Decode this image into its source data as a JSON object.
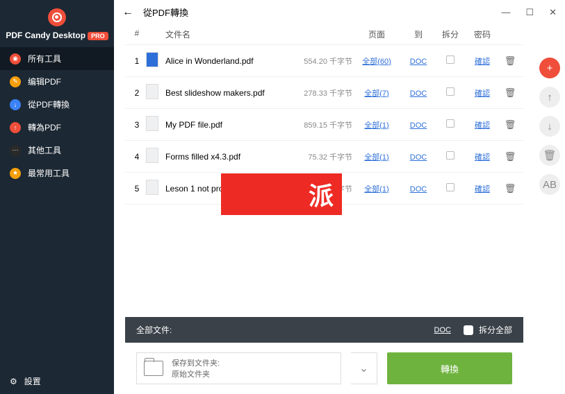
{
  "app": {
    "name": "PDF Candy Desktop",
    "badge": "PRO"
  },
  "window": {
    "title": "從PDF轉換"
  },
  "sidebar": {
    "items": [
      {
        "label": "所有工具"
      },
      {
        "label": "编辑PDF"
      },
      {
        "label": "從PDF轉換"
      },
      {
        "label": "轉為PDF"
      },
      {
        "label": "其他工具"
      },
      {
        "label": "最常用工具"
      }
    ],
    "settings": "設置"
  },
  "table": {
    "headers": {
      "num": "#",
      "name": "文件名",
      "pages": "页面",
      "to": "到",
      "split": "拆分",
      "pwd": "密码"
    },
    "rows": [
      {
        "num": "1",
        "name": "Alice in Wonderland.pdf",
        "size": "554.20 千字节",
        "pages": "全部(60)",
        "to": "DOC",
        "pwd": "確認"
      },
      {
        "num": "2",
        "name": "Best slideshow makers.pdf",
        "size": "278.33 千字节",
        "pages": "全部(7)",
        "to": "DOC",
        "pwd": "確認"
      },
      {
        "num": "3",
        "name": "My PDF file.pdf",
        "size": "859.15 千字节",
        "pages": "全部(1)",
        "to": "DOC",
        "pwd": "確認"
      },
      {
        "num": "4",
        "name": "Forms filled x4.3.pdf",
        "size": "75.32 千字节",
        "pages": "全部(1)",
        "to": "DOC",
        "pwd": "確認"
      },
      {
        "num": "5",
        "name": "Leson 1 not protected.pdf",
        "size": "189.55 千字节",
        "pages": "全部(1)",
        "to": "DOC",
        "pwd": "確認"
      }
    ]
  },
  "footer": {
    "all_files": "全部文件:",
    "convert_type": "DOC",
    "split_all": "拆分全部"
  },
  "bottom": {
    "save_to_label": "保存到文件夹:",
    "save_to_value": "原始文件夹",
    "convert": "轉換"
  },
  "tools": {
    "ab": "AB"
  },
  "watermark": "派"
}
